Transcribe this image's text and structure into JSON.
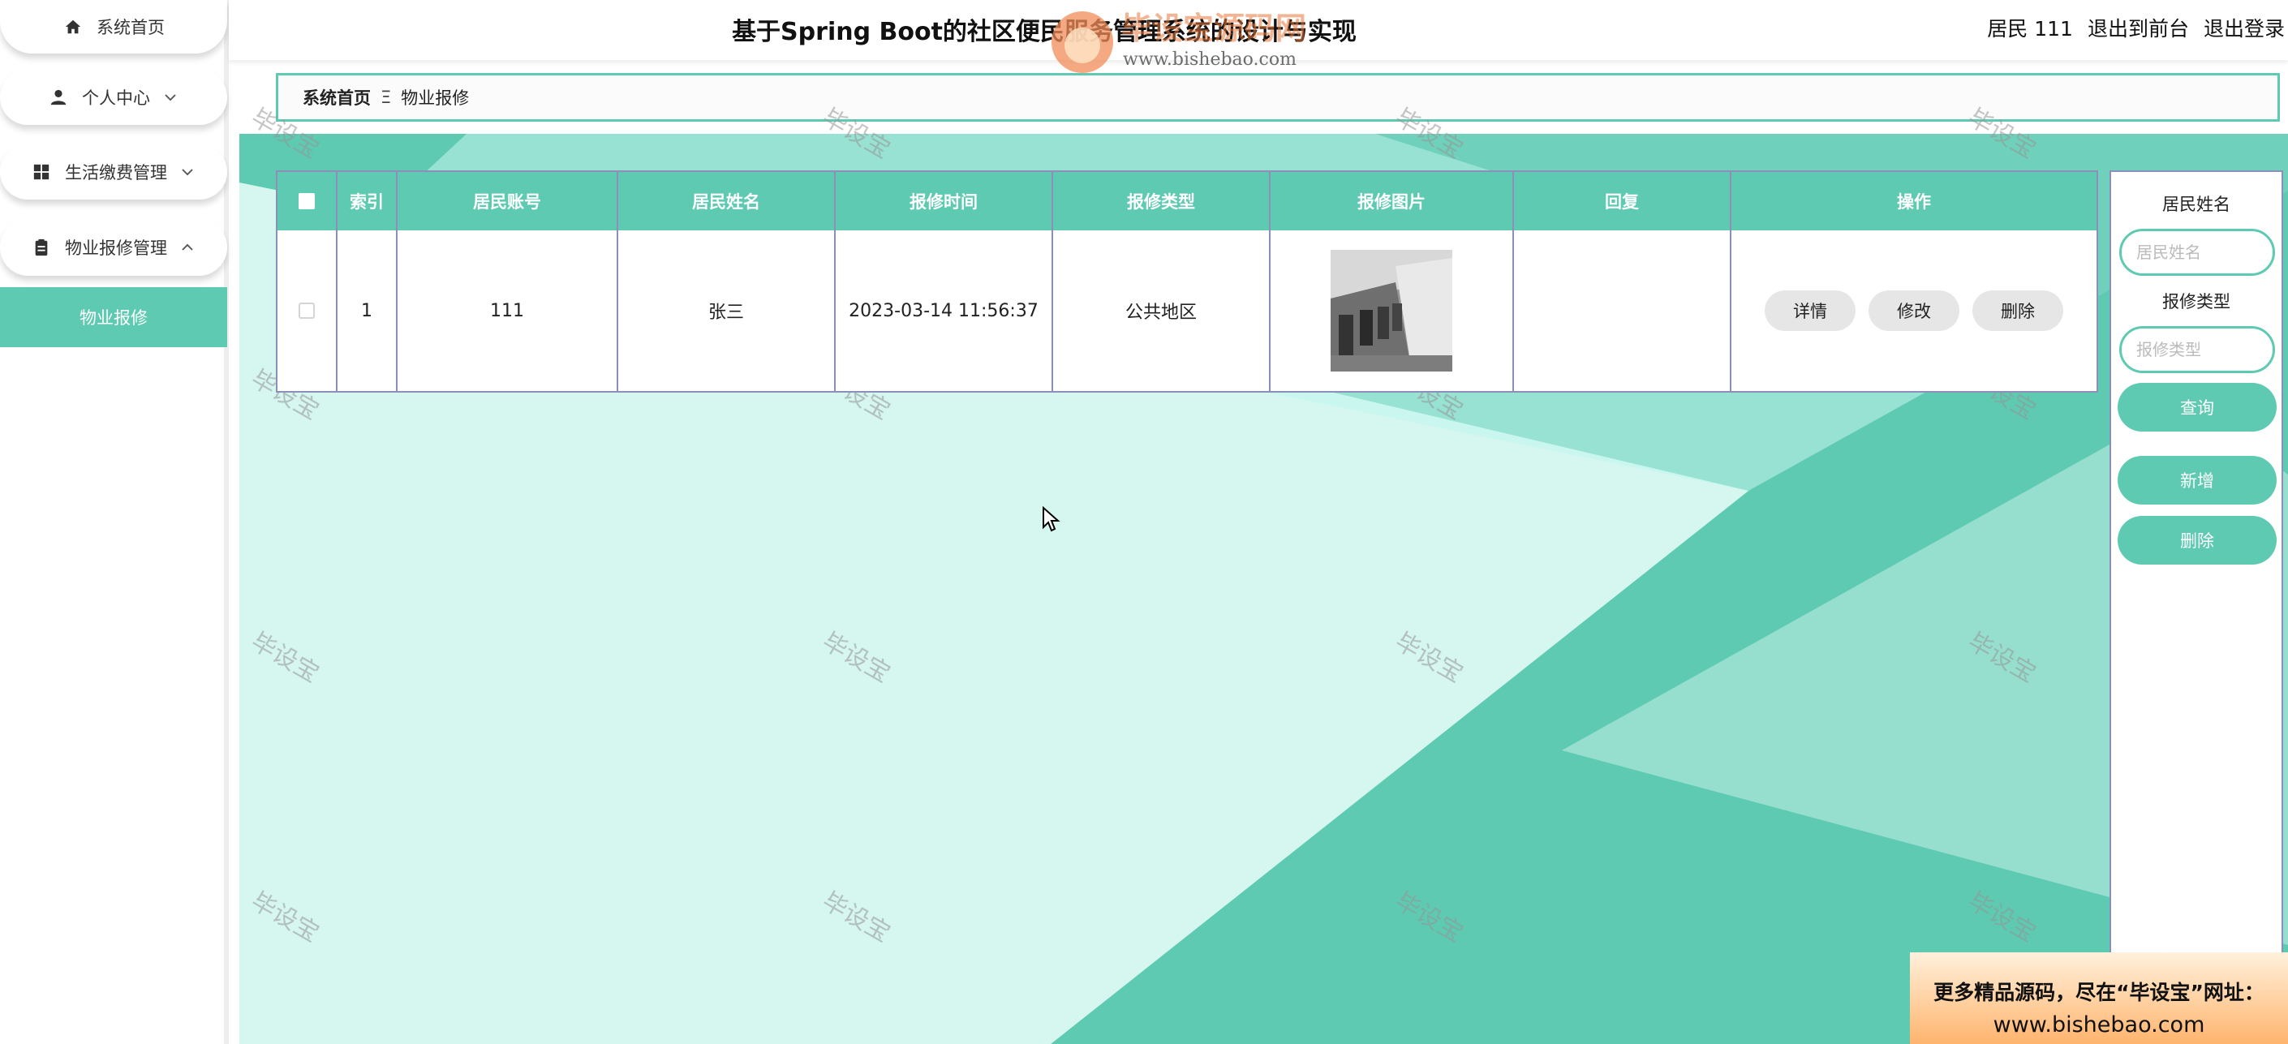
{
  "header": {
    "title": "基于Spring Boot的社区便民服务管理系统的设计与实现",
    "user_label": "居民 111",
    "front_label": "退出到前台",
    "logout_label": "退出登录",
    "logo_text": "毕设宝源码网",
    "logo_url": "www.bishebao.com"
  },
  "sidebar": {
    "items": [
      {
        "label": "系统首页",
        "icon": "home-icon"
      },
      {
        "label": "个人中心",
        "icon": "person-icon"
      },
      {
        "label": "生活缴费管理",
        "icon": "grid-icon"
      },
      {
        "label": "物业报修管理",
        "icon": "clipboard-icon"
      }
    ],
    "sub_item": "物业报修"
  },
  "breadcrumb": {
    "home": "系统首页",
    "separator": "Ξ",
    "current": "物业报修"
  },
  "table": {
    "columns": [
      "索引",
      "居民账号",
      "居民姓名",
      "报修时间",
      "报修类型",
      "报修图片",
      "回复",
      "操作"
    ],
    "rows": [
      {
        "index": "1",
        "account": "111",
        "name": "张三",
        "time": "2023-03-14 11:56:37",
        "type": "公共地区",
        "reply": ""
      }
    ],
    "actions": {
      "detail": "详情",
      "edit": "修改",
      "delete": "删除"
    }
  },
  "search_panel": {
    "name_label": "居民姓名",
    "name_placeholder": "居民姓名",
    "type_label": "报修类型",
    "type_placeholder": "报修类型",
    "query_button": "查询",
    "add_button": "新增",
    "delete_button": "删除"
  },
  "watermark_text": "毕设宝",
  "promo": {
    "line1": "更多精品源码，尽在“毕设宝”网址：",
    "line2": "www.bishebao.com"
  },
  "colors": {
    "accent": "#5ecab1",
    "background_light": "#c8f6ee",
    "table_border": "#8c8fb8"
  }
}
